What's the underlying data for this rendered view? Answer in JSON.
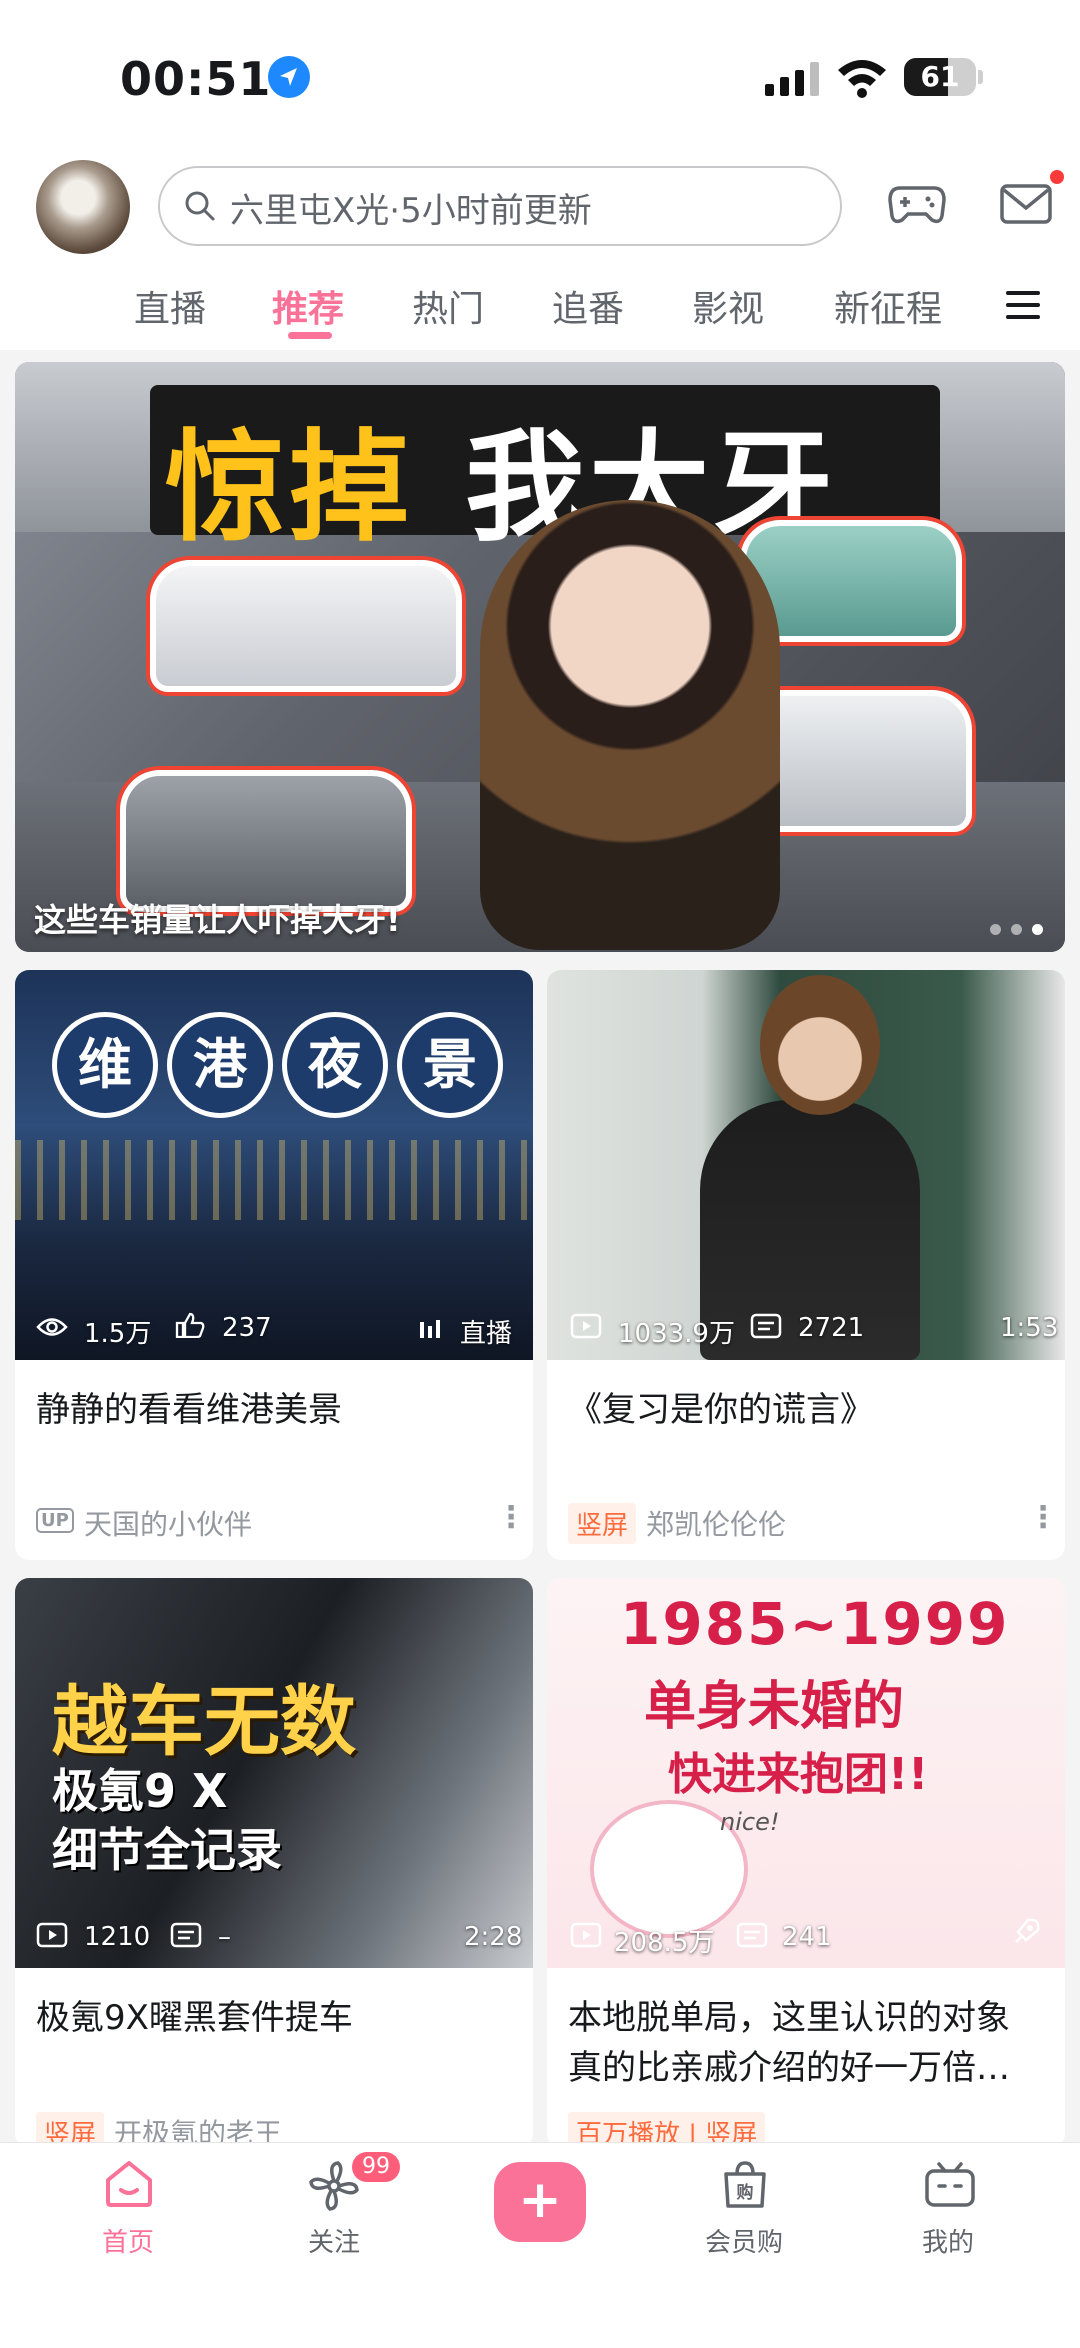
{
  "status_bar": {
    "time": "00:51",
    "battery": "61",
    "battery_level": 0.61
  },
  "header": {
    "search_placeholder": "六里屯X光·5小时前更新",
    "tabs": [
      {
        "label": "直播",
        "active": false
      },
      {
        "label": "推荐",
        "active": true
      },
      {
        "label": "热门",
        "active": false
      },
      {
        "label": "追番",
        "active": false
      },
      {
        "label": "影视",
        "active": false
      },
      {
        "label": "新征程",
        "active": false
      }
    ]
  },
  "banner": {
    "title_part1": "惊掉",
    "title_part2": "我大牙",
    "caption": "这些车销量让人吓掉大牙!",
    "dots": 3,
    "active_dot": 3
  },
  "cards": [
    {
      "thumb_text": [
        "维",
        "港",
        "夜",
        "景"
      ],
      "stat1": "1.5万",
      "stat2": "237",
      "corner": "直播",
      "title": "静静的看看维港美景",
      "badge": "UP",
      "author": "天国的小伙伴"
    },
    {
      "stat1": "1033.9万",
      "stat2": "2721",
      "corner": "1:53",
      "title": "《复习是你的谎言》",
      "tag": "竖屏",
      "author": "郑凯伦伦伦"
    },
    {
      "thumb_text": [
        "越车无数",
        "极氪9 X",
        "细节全记录"
      ],
      "stat1": "1210",
      "stat2": "–",
      "corner": "2:28",
      "title": "极氪9X曜黑套件提车",
      "tag": "竖屏",
      "author": "开极氪的老王"
    },
    {
      "thumb_text": [
        "1985~1999",
        "单身未婚的",
        "快进来抱团!!",
        "nice!"
      ],
      "stat1": "208.5万",
      "stat2": "241",
      "title_line1": "本地脱单局，这里认识的对象",
      "title_line2": "真的比亲戚介绍的好一万倍…",
      "tag": "百万播放 | 竖屏"
    }
  ],
  "bottom_nav": {
    "items": [
      {
        "label": "首页",
        "active": true
      },
      {
        "label": "关注",
        "badge": "99"
      },
      {
        "label": "会员购"
      },
      {
        "label": "我的"
      }
    ],
    "plus": "+"
  },
  "colors": {
    "accent": "#fb7299",
    "tag": "#ff6b3d"
  }
}
